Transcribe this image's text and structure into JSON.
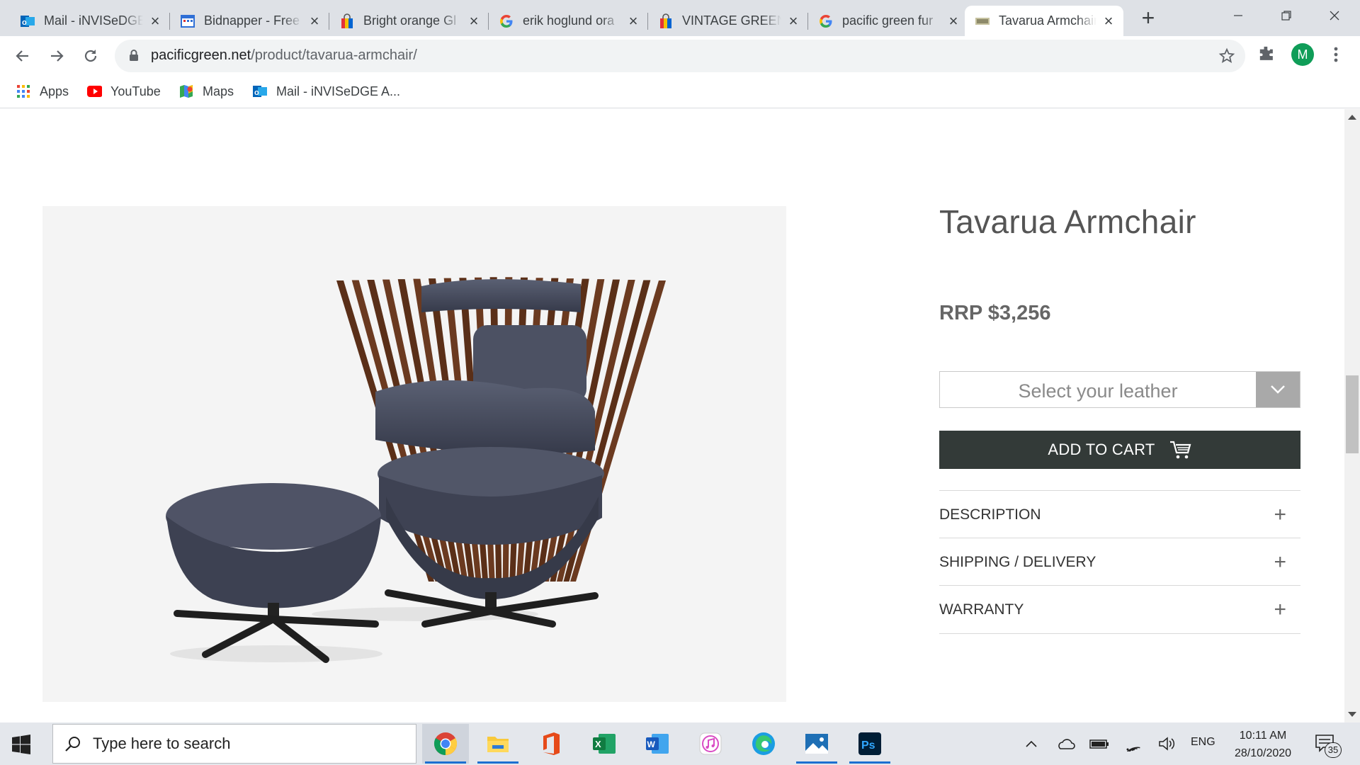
{
  "browser": {
    "tabs": [
      {
        "title": "Mail - iNVISeDGE A",
        "icon": "outlook-icon"
      },
      {
        "title": "Bidnapper - Free",
        "icon": "calendar-icon"
      },
      {
        "title": "Bright orange Gl",
        "icon": "shopping-bag-icon"
      },
      {
        "title": "erik hoglund ora",
        "icon": "google-icon"
      },
      {
        "title": "VINTAGE GREEN",
        "icon": "shopping-bag-icon"
      },
      {
        "title": "pacific green fur",
        "icon": "google-icon"
      },
      {
        "title": "Tavarua Armchair",
        "icon": "site-favicon-icon"
      }
    ],
    "url_host": "pacificgreen.net",
    "url_path": "/product/tavarua-armchair/",
    "profile_initial": "M",
    "bookmarks": [
      {
        "label": "Apps",
        "icon": "apps-grid-icon"
      },
      {
        "label": "YouTube",
        "icon": "youtube-icon"
      },
      {
        "label": "Maps",
        "icon": "maps-icon"
      },
      {
        "label": "Mail - iNVISeDGE A...",
        "icon": "outlook-icon"
      }
    ]
  },
  "product": {
    "title": "Tavarua Armchair",
    "price": "RRP $3,256",
    "leather_placeholder": "Select your leather",
    "add_to_cart": "ADD TO CART",
    "accordion": [
      {
        "label": "DESCRIPTION"
      },
      {
        "label": "SHIPPING / DELIVERY"
      },
      {
        "label": "WARRANTY"
      }
    ]
  },
  "taskbar": {
    "search_placeholder": "Type here to search",
    "language": "ENG",
    "time": "10:11 AM",
    "date": "28/10/2020",
    "notification_count": "35",
    "apps": [
      "chrome-icon",
      "file-explorer-icon",
      "office-icon",
      "excel-icon",
      "word-icon",
      "itunes-icon",
      "edge-icon",
      "photos-icon",
      "photoshop-icon"
    ]
  },
  "colors": {
    "tab_strip": "#dee1e6",
    "cart_button": "#333a38",
    "leather_dropdown": "#a9a9a9",
    "chair_leather": "#4a4f62",
    "chair_wood": "#6b3a20"
  }
}
